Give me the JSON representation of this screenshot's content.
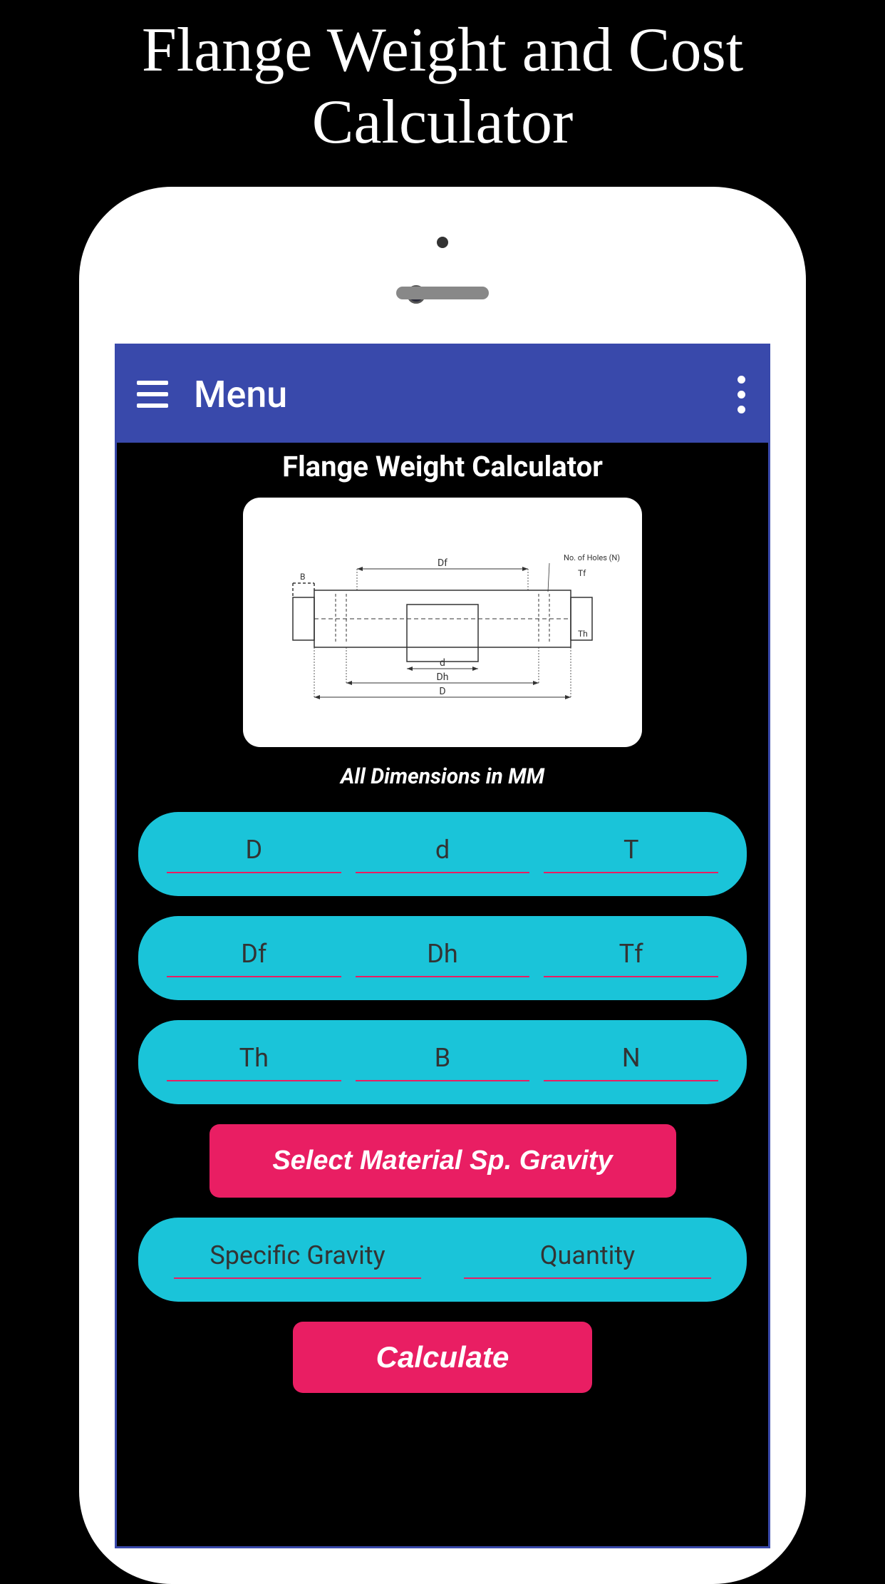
{
  "promo": {
    "title": "Flange Weight and Cost Calculator"
  },
  "appbar": {
    "title": "Menu"
  },
  "page": {
    "title": "Flange Weight Calculator",
    "dimensions_note": "All Dimensions in MM"
  },
  "diagram": {
    "labels": {
      "df": "Df",
      "tf": "Tf",
      "d_lower": "d",
      "dh": "Dh",
      "d_upper": "D",
      "th": "Th",
      "b": "B",
      "holes": "No. of Holes (N)"
    }
  },
  "inputs": {
    "row1": [
      {
        "label": "D"
      },
      {
        "label": "d"
      },
      {
        "label": "T"
      }
    ],
    "row2": [
      {
        "label": "Df"
      },
      {
        "label": "Dh"
      },
      {
        "label": "Tf"
      }
    ],
    "row3": [
      {
        "label": "Th"
      },
      {
        "label": "B"
      },
      {
        "label": "N"
      }
    ],
    "row4": [
      {
        "label": "Specific Gravity"
      },
      {
        "label": "Quantity"
      }
    ]
  },
  "buttons": {
    "select_material": "Select Material Sp. Gravity",
    "calculate": "Calculate"
  }
}
